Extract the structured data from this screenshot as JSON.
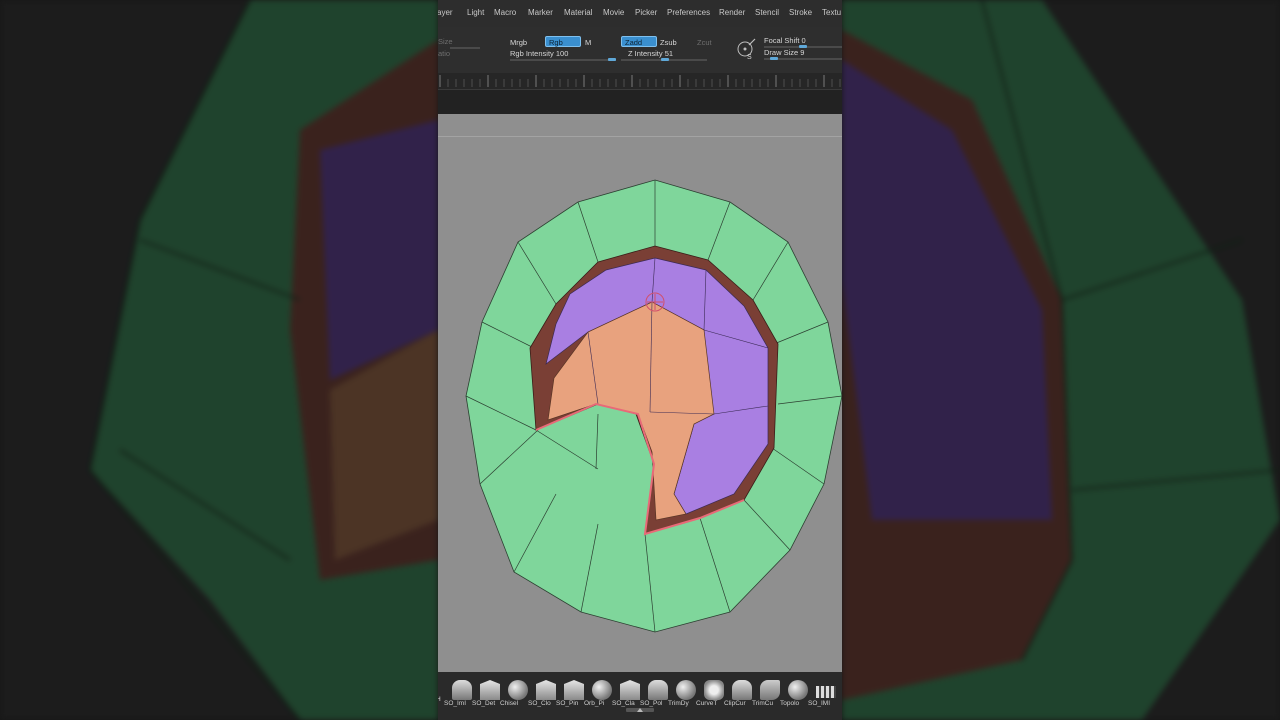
{
  "menu": {
    "items": [
      "Layer",
      "Light",
      "Macro",
      "Marker",
      "Material",
      "Movie",
      "Picker",
      "Preferences",
      "Render",
      "Stencil",
      "Stroke",
      "Texture"
    ],
    "display": [
      "ayer",
      "Light",
      "Macro",
      "Marker",
      "Material",
      "Movie",
      "Picker",
      "Preferences",
      "Render",
      "Stencil",
      "Stroke",
      "Textu"
    ]
  },
  "topshelf": {
    "size_cut": "Size",
    "ratio_cut": "atio",
    "mrgb": "Mrgb",
    "rgb": "Rgb",
    "m": "M",
    "rgb_intensity_label": "Rgb Intensity",
    "rgb_intensity_value": "100",
    "zadd": "Zadd",
    "zsub": "Zsub",
    "zcut": "Zcut",
    "z_intensity_label": "Z Intensity",
    "z_intensity_value": "51",
    "focal_shift_label": "Focal Shift",
    "focal_shift_value": "0",
    "draw_size_label": "Draw Size",
    "draw_size_value": "9",
    "rgb_intensity_fraction": 1.0,
    "z_intensity_fraction": 0.51,
    "focal_shift_fraction": 0.5,
    "draw_size_fraction": 0.09
  },
  "brushes": [
    {
      "label": "SO_ImI",
      "icon": "h-brush-icon"
    },
    {
      "label": "SO_Det",
      "icon": "frame-brush-icon"
    },
    {
      "label": "Chisel",
      "icon": "chisel-brush-icon"
    },
    {
      "label": "SO_Clo",
      "icon": "clay-brush-icon"
    },
    {
      "label": "SO_Pin",
      "icon": "pinch-brush-icon"
    },
    {
      "label": "Orb_Pi",
      "icon": "orb-sphere-icon"
    },
    {
      "label": "SO_Cla",
      "icon": "clay-tubes-icon"
    },
    {
      "label": "SO_Pol",
      "icon": "polish-brush-icon"
    },
    {
      "label": "TrimDy",
      "icon": "trim-sphere-icon"
    },
    {
      "label": "CurveT",
      "icon": "curve-tube-icon"
    },
    {
      "label": "ClipCur",
      "icon": "clip-curve-icon"
    },
    {
      "label": "TrimCu",
      "icon": "trim-curve-icon"
    },
    {
      "label": "Topolo",
      "icon": "topology-icon"
    },
    {
      "label": "SO_IMI",
      "icon": "insert-mesh-icon"
    }
  ],
  "brush_prefix": "H",
  "colors": {
    "mesh_green": "#7fd69b",
    "mesh_purple": "#a97fe2",
    "mesh_orange": "#e8a27e",
    "mesh_wall": "#7a3f35",
    "mesh_edge_pink": "#e86a78",
    "viewport_bg": "#8f8f8f",
    "accent_blue": "#3a8fcf"
  }
}
